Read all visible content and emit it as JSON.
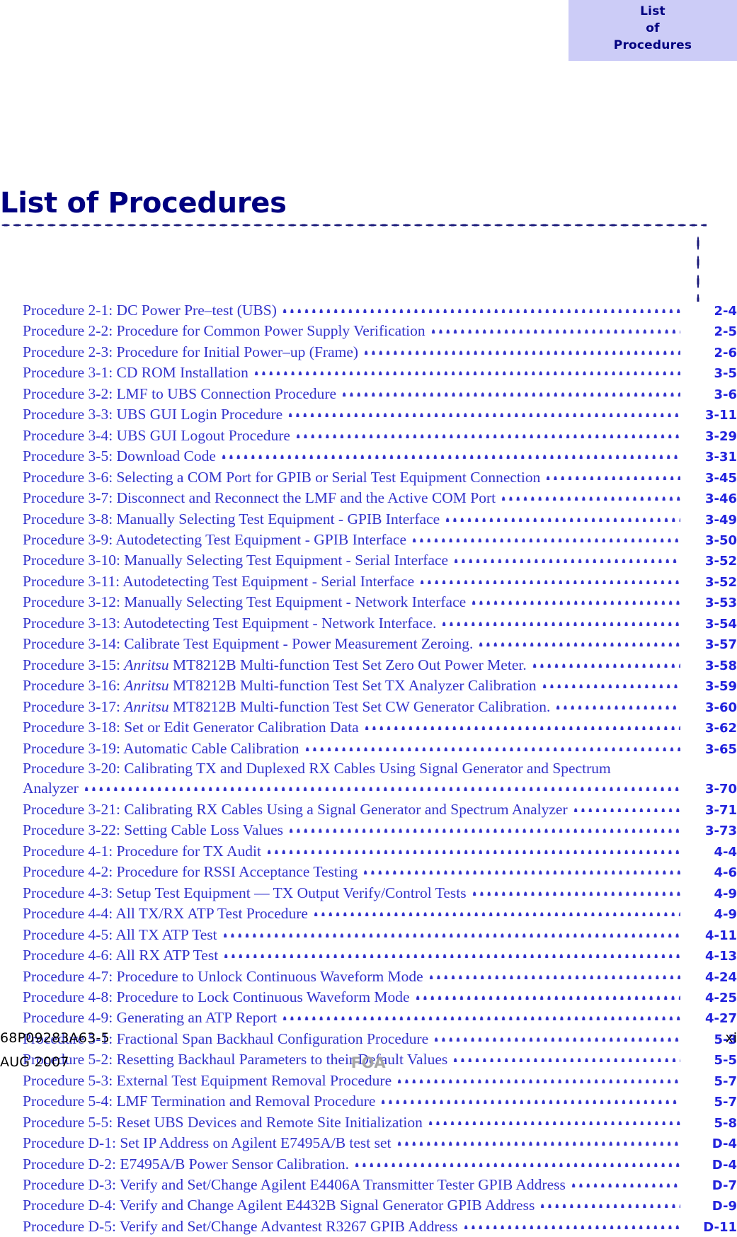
{
  "page_tab": {
    "lines": [
      "List",
      "of",
      "Procedures"
    ],
    "background_color": "#CCCCF7",
    "text_color": "#000080"
  },
  "title": "List of Procedures",
  "title_color": "#000080",
  "list_text_color": "#3333CC",
  "page_number_color": "#2222DD",
  "procedures": [
    {
      "label": "Procedure 2-1:  DC Power Pre–test (UBS)",
      "page": "2-4"
    },
    {
      "label": "Procedure 2-2:  Procedure for Common Power Supply Verification",
      "page": "2-5"
    },
    {
      "label": "Procedure 2-3:  Procedure for Initial Power–up (Frame)",
      "page": "2-6"
    },
    {
      "label": "Procedure 3-1:  CD ROM Installation",
      "page": "3-5"
    },
    {
      "label": "Procedure 3-2:  LMF to UBS Connection Procedure",
      "page": "3-6"
    },
    {
      "label": "Procedure 3-3:  UBS GUI Login Procedure",
      "page": "3-11"
    },
    {
      "label": "Procedure 3-4:  UBS GUI Logout Procedure",
      "page": "3-29"
    },
    {
      "label": "Procedure 3-5:  Download Code",
      "page": "3-31"
    },
    {
      "label": "Procedure 3-6:  Selecting a COM Port for GPIB or Serial Test Equipment Connection",
      "page": "3-45"
    },
    {
      "label": "Procedure 3-7:  Disconnect and Reconnect the LMF and the Active COM Port",
      "page": "3-46"
    },
    {
      "label": "Procedure 3-8:  Manually Selecting Test Equipment - GPIB Interface",
      "page": "3-49"
    },
    {
      "label": "Procedure 3-9:  Autodetecting Test Equipment - GPIB Interface",
      "page": "3-50"
    },
    {
      "label": "Procedure 3-10:  Manually Selecting Test Equipment - Serial Interface",
      "page": "3-52"
    },
    {
      "label": "Procedure 3-11:  Autodetecting Test Equipment - Serial Interface",
      "page": "3-52"
    },
    {
      "label": "Procedure 3-12:  Manually Selecting Test Equipment - Network Interface",
      "page": "3-53"
    },
    {
      "label": "Procedure 3-13:  Autodetecting Test Equipment - Network Interface.",
      "page": "3-54"
    },
    {
      "label": "Procedure 3-14:  Calibrate Test Equipment - Power Measurement Zeroing.",
      "page": "3-57"
    },
    {
      "label": "Procedure 3-15:  ",
      "italic": "Anritsu",
      "label_after": " MT8212B Multi-function Test Set Zero Out Power Meter.",
      "page": "3-58"
    },
    {
      "label": "Procedure 3-16:  ",
      "italic": "Anritsu",
      "label_after": " MT8212B Multi-function Test Set TX Analyzer Calibration",
      "page": "3-59"
    },
    {
      "label": "Procedure 3-17:  ",
      "italic": "Anritsu",
      "label_after": " MT8212B Multi-function Test Set CW Generator Calibration.",
      "page": "3-60"
    },
    {
      "label": "Procedure 3-18:  Set or Edit Generator Calibration Data",
      "page": "3-62"
    },
    {
      "label": "Procedure 3-19:  Automatic Cable Calibration",
      "page": "3-65"
    },
    {
      "label": "Procedure 3-20:  Calibrating TX and Duplexed RX Cables Using Signal Generator and Spectrum",
      "label_wrap": "Analyzer",
      "page": "3-70"
    },
    {
      "label": "Procedure 3-21:  Calibrating RX Cables Using a Signal Generator and Spectrum Analyzer",
      "page": "3-71"
    },
    {
      "label": "Procedure 3-22:  Setting Cable Loss Values",
      "page": "3-73"
    },
    {
      "label": "Procedure 4-1:  Procedure for TX Audit",
      "page": "4-4"
    },
    {
      "label": "Procedure 4-2:  Procedure for RSSI Acceptance Testing",
      "page": "4-6"
    },
    {
      "label": "Procedure 4-3:  Setup Test Equipment — TX Output Verify/Control Tests",
      "page": "4-9"
    },
    {
      "label": "Procedure 4-4:  All TX/RX ATP Test Procedure",
      "page": "4-9"
    },
    {
      "label": "Procedure 4-5:  All TX ATP Test",
      "page": "4-11"
    },
    {
      "label": "Procedure 4-6:  All RX ATP Test",
      "page": "4-13"
    },
    {
      "label": "Procedure 4-7:  Procedure to Unlock Continuous Waveform Mode",
      "page": "4-24"
    },
    {
      "label": "Procedure 4-8:  Procedure to Lock Continuous Waveform Mode",
      "page": "4-25"
    },
    {
      "label": "Procedure 4-9:  Generating an ATP Report",
      "page": "4-27"
    },
    {
      "label": "Procedure 5-1:  Fractional Span Backhaul Configuration Procedure",
      "page": "5-3"
    },
    {
      "label": "Procedure 5-2:  Resetting Backhaul Parameters to their Default Values",
      "page": "5-5"
    },
    {
      "label": "Procedure 5-3:  External Test Equipment Removal Procedure",
      "page": "5-7"
    },
    {
      "label": "Procedure 5-4:  LMF Termination and Removal Procedure",
      "page": "5-7"
    },
    {
      "label": "Procedure 5-5:  Reset UBS Devices and Remote Site Initialization",
      "page": "5-8"
    },
    {
      "label": "Procedure D-1:  Set IP Address on Agilent E7495A/B test set",
      "page": "D-4"
    },
    {
      "label": "Procedure D-2:  E7495A/B Power Sensor Calibration.",
      "page": "D-4"
    },
    {
      "label": "Procedure D-3:  Verify and Set/Change Agilent E4406A Transmitter Tester GPIB Address",
      "page": "D-7"
    },
    {
      "label": "Procedure D-4:  Verify and Change Agilent E4432B Signal Generator GPIB Address",
      "page": "D-9"
    },
    {
      "label": "Procedure D-5:  Verify and Set/Change Advantest R3267 GPIB Address",
      "page": "D-11"
    }
  ],
  "footer": {
    "part_number": "68P09283A63-5",
    "page_marker": "xi",
    "date": "AUG 2007",
    "status": "FOA",
    "status_color": "#A6A6A6"
  }
}
